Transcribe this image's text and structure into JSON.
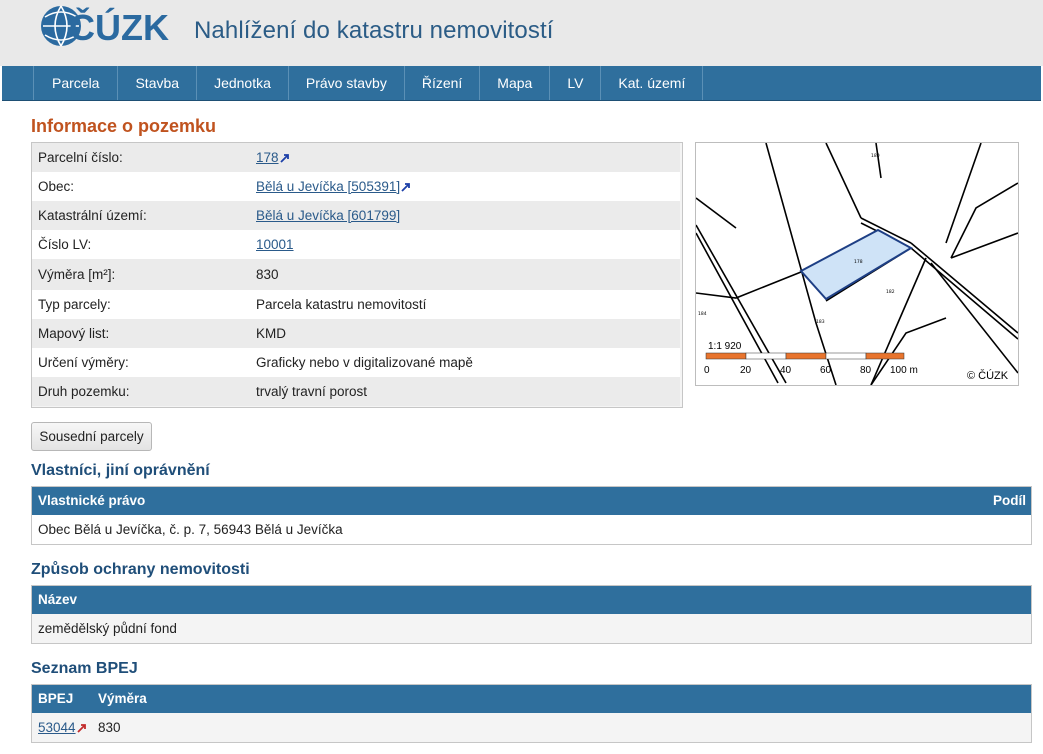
{
  "header": {
    "logo_text": "ČÚZK",
    "title": "Nahlížení do katastru nemovitostí"
  },
  "nav": {
    "items": [
      "Parcela",
      "Stavba",
      "Jednotka",
      "Právo stavby",
      "Řízení",
      "Mapa",
      "LV",
      "Kat. území"
    ]
  },
  "info": {
    "title": "Informace o pozemku",
    "rows": [
      {
        "label": "Parcelní číslo:",
        "value": "178",
        "link": true,
        "ext": true
      },
      {
        "label": "Obec:",
        "value": "Bělá u Jevíčka [505391]",
        "link": true,
        "ext": true
      },
      {
        "label": "Katastrální území:",
        "value": "Bělá u Jevíčka [601799]",
        "link": true,
        "ext": false
      },
      {
        "label": "Číslo LV:",
        "value": "10001",
        "link": true,
        "ext": false
      },
      {
        "label": "Výměra [m²]:",
        "value": "830",
        "link": false,
        "ext": false
      },
      {
        "label": "Typ parcely:",
        "value": "Parcela katastru nemovitostí",
        "link": false,
        "ext": false
      },
      {
        "label": "Mapový list:",
        "value": "KMD",
        "link": false,
        "ext": false
      },
      {
        "label": "Určení výměry:",
        "value": "Graficky nebo v digitalizované mapě",
        "link": false,
        "ext": false
      },
      {
        "label": "Druh pozemku:",
        "value": "trvalý travní porost",
        "link": false,
        "ext": false
      }
    ]
  },
  "map": {
    "scale": "1:1 920",
    "ticks": [
      "0",
      "20",
      "40",
      "60",
      "80",
      "100 m"
    ],
    "copyright": "© ČÚZK",
    "parcel_labels": [
      "178",
      "180",
      "182",
      "183",
      "184"
    ]
  },
  "neighbors_button": "Sousední parcely",
  "owners": {
    "title": "Vlastníci, jiní oprávnění",
    "col_right": "Vlastnické právo",
    "col_share": "Podíl",
    "rows": [
      "Obec Bělá u Jevíčka, č. p. 7, 56943 Bělá u Jevíčka"
    ]
  },
  "protection": {
    "title": "Způsob ochrany nemovitosti",
    "col_name": "Název",
    "rows": [
      "zemědělský půdní fond"
    ]
  },
  "bpej": {
    "title": "Seznam BPEJ",
    "col_bpej": "BPEJ",
    "col_area": "Výměra",
    "rows": [
      {
        "code": "53044",
        "area": "830"
      }
    ]
  },
  "colors": {
    "nav_bg": "#2f6f9d",
    "title_orange": "#c0531f",
    "heading_blue": "#1f4e79",
    "parcel_fill": "#cfe3f7"
  }
}
